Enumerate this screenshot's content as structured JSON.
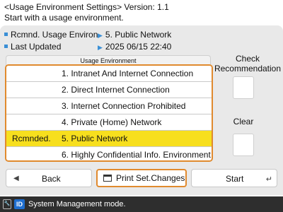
{
  "header": {
    "title": "<Usage Environment Settings> Version: 1.1",
    "subtitle": "Start with a usage environment."
  },
  "info": {
    "recommended_label": "Rcmnd. Usage Environ.",
    "recommended_value": "5. Public Network",
    "updated_label": "Last Updated",
    "updated_value": "2025 06/15 22:40"
  },
  "list": {
    "header": "Usage Environment",
    "items": [
      {
        "tag": "",
        "label": "1. Intranet And Internet Connection"
      },
      {
        "tag": "",
        "label": "2. Direct Internet Connection"
      },
      {
        "tag": "",
        "label": "3. Internet Connection Prohibited"
      },
      {
        "tag": "",
        "label": "4. Private (Home) Network"
      },
      {
        "tag": "Rcmnded.",
        "label": "5. Public Network"
      },
      {
        "tag": "",
        "label": "6. Highly Confidential Info. Environment"
      }
    ],
    "selected_index": 4
  },
  "right": {
    "check_label": "Check\nRecommendation",
    "clear_label": "Clear"
  },
  "buttons": {
    "back": "Back",
    "print": "Print Set.Changes",
    "start": "Start"
  },
  "status": {
    "badge": "ID",
    "text": "System Management mode."
  },
  "colors": {
    "accent_orange": "#e08a2e",
    "selected_row": "#f7df1e",
    "bullet_blue": "#3a8fd6",
    "status_bar": "#2e2e2e"
  }
}
